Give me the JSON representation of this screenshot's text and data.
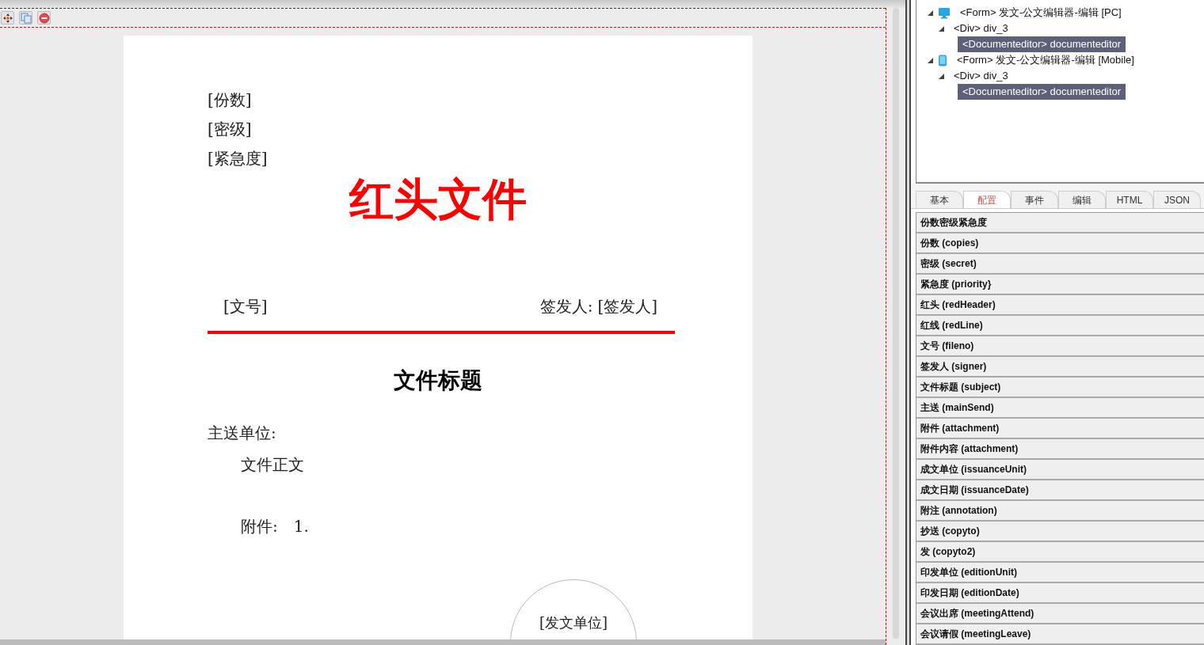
{
  "toolbar": {
    "buttons": [
      {
        "kind": "move"
      },
      {
        "kind": "copy"
      },
      {
        "kind": "delete"
      }
    ]
  },
  "document": {
    "copies": "[份数]",
    "secret": "[密级]",
    "priority": "[紧急度]",
    "red_header": "红头文件",
    "file_no": "[文号]",
    "signer_label": "签发人:",
    "signer": "[签发人]",
    "subject": "文件标题",
    "main_send": "主送单位:",
    "body": "文件正文",
    "attachment_label": "附件:",
    "attachment_item": "1.",
    "seal": "[发文单位]"
  },
  "tree": [
    {
      "kind": "pc_form",
      "label": "<Form> 发文-公文编辑器-编辑 [PC]",
      "expanded": true,
      "children": [
        {
          "kind": "div",
          "label": "<Div> div_3",
          "expanded": true,
          "children": [
            {
              "kind": "component",
              "label": "<Documenteditor> documenteditor",
              "selected": true
            }
          ]
        }
      ]
    },
    {
      "kind": "mobile_form",
      "label": "<Form> 发文-公文编辑器-编辑 [Mobile]",
      "expanded": true,
      "children": [
        {
          "kind": "div",
          "label": "<Div> div_3",
          "expanded": true,
          "children": [
            {
              "kind": "component",
              "label": "<Documenteditor> documenteditor",
              "selected": true
            }
          ]
        }
      ]
    }
  ],
  "tabs": [
    {
      "label": "基本",
      "selected": false
    },
    {
      "label": "配置",
      "selected": true
    },
    {
      "label": "事件",
      "selected": false
    },
    {
      "label": "编辑",
      "selected": false
    },
    {
      "label": "HTML",
      "selected": false
    },
    {
      "label": "JSON",
      "selected": false
    }
  ],
  "properties": [
    "份数密级紧急度",
    "份数 (copies)",
    "密级 (secret)",
    "紧急度 (priority}",
    "红头 (redHeader)",
    "红线 (redLine)",
    "文号 (fileno)",
    "签发人 (signer)",
    "文件标题 (subject)",
    "主送 (mainSend)",
    "附件 (attachment)",
    "附件内容 (attachment)",
    "成文单位 (issuanceUnit)",
    "成文日期 (issuanceDate)",
    "附注 (annotation)",
    "抄送 (copyto)",
    "发 (copyto2)",
    "印发单位 (editionUnit)",
    "印发日期 (editionDate)",
    "会议出席 (meetingAttend)",
    "会议请假 (meetingLeave)"
  ]
}
